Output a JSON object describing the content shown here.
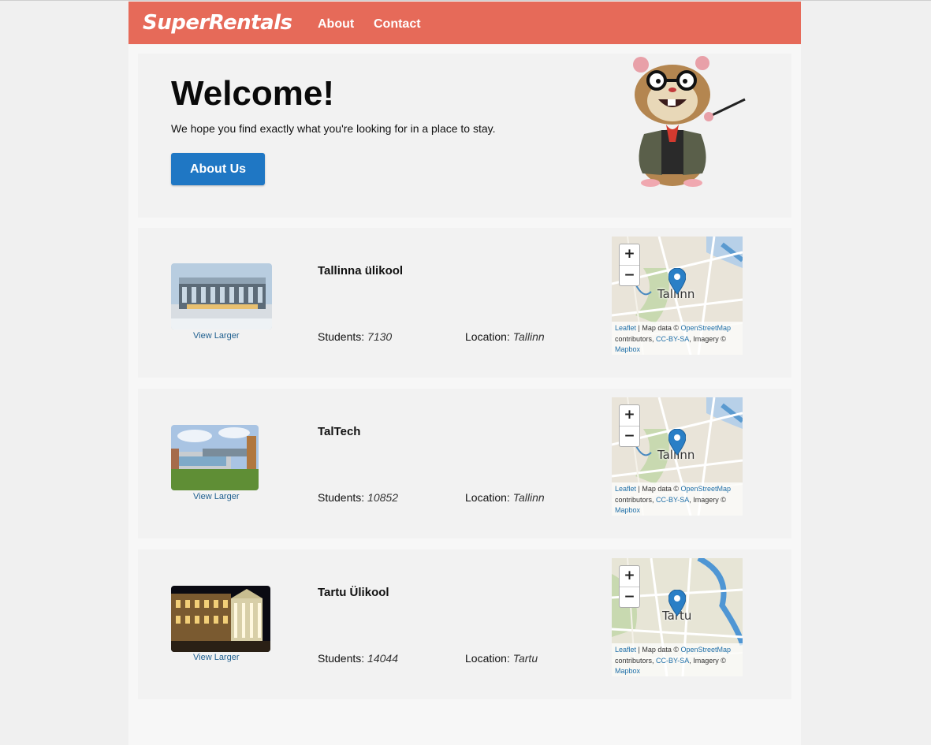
{
  "nav": {
    "brand": "SuperRentals",
    "about": "About",
    "contact": "Contact"
  },
  "jumbo": {
    "title": "Welcome!",
    "subtitle": "We hope you find exactly what you're looking for in a place to stay.",
    "button": "About Us"
  },
  "labels": {
    "students": "Students:",
    "location": "Location:",
    "view_larger": "View Larger"
  },
  "map_attribution": {
    "leaflet": "Leaflet",
    "sep": " | Map data © ",
    "osm": "OpenStreetMap",
    "contrib": " contributors, ",
    "license": "CC-BY-SA",
    "imagery": ", Imagery © ",
    "mapbox": "Mapbox"
  },
  "zoom": {
    "plus": "+",
    "minus": "−"
  },
  "listings": [
    {
      "title": "Tallinna ülikool",
      "students": "7130",
      "location": "Tallinn",
      "map_city": "Tallinn"
    },
    {
      "title": "TalTech",
      "students": "10852",
      "location": "Tallinn",
      "map_city": "Tallinn"
    },
    {
      "title": "Tartu Ülikool",
      "students": "14044",
      "location": "Tartu",
      "map_city": "Tartu"
    }
  ],
  "colors": {
    "navbar": "#e66a59",
    "button": "#1f77c4",
    "link": "#1f5f8f",
    "pin": "#2a7fc6"
  }
}
